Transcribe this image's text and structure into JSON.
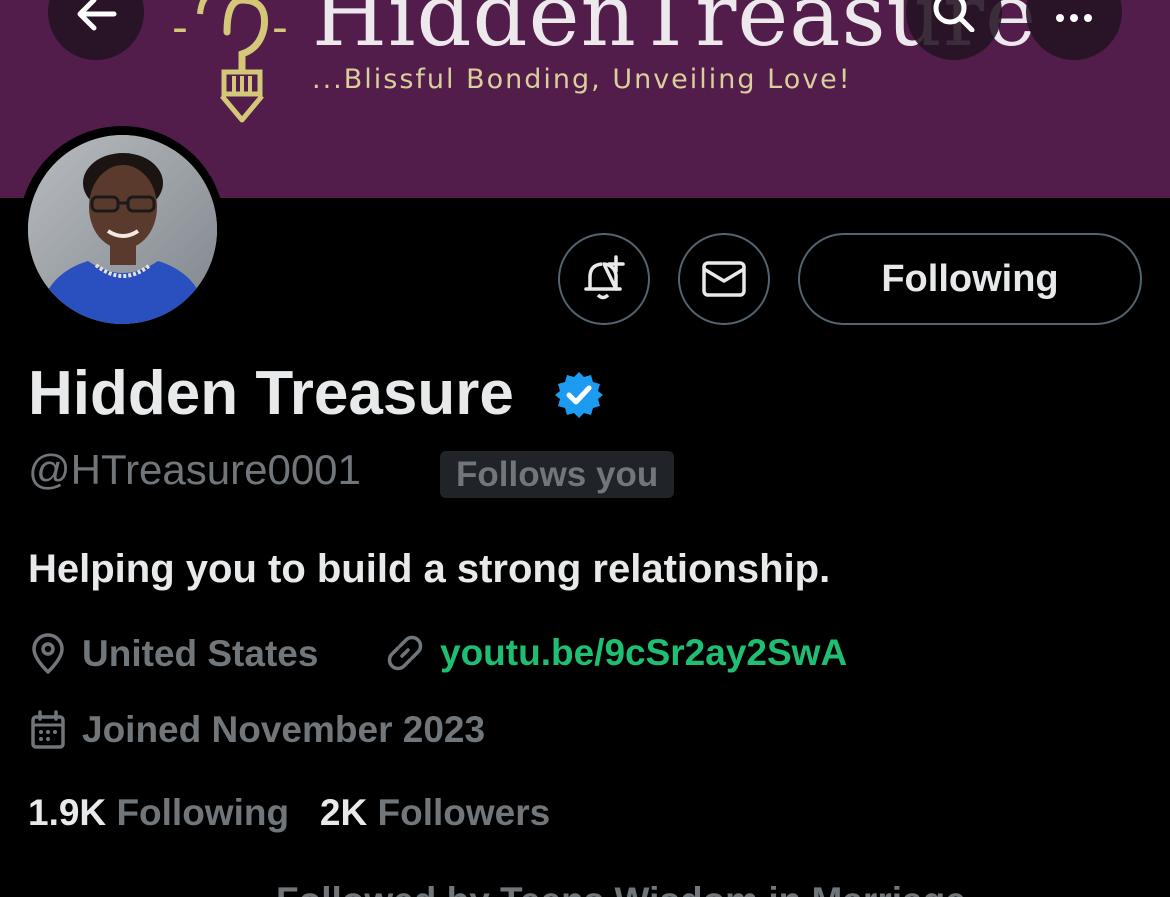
{
  "banner": {
    "brand_name": "HiddenTreasure",
    "tagline": "...Blissful Bonding, Unveiling Love!",
    "background_color": "#521c4b",
    "back_icon": "arrow-left-icon",
    "search_icon": "search-icon",
    "more_icon": "more-horizontal-icon"
  },
  "actions": {
    "notify_icon": "bell-plus-icon",
    "message_icon": "envelope-icon",
    "following_label": "Following"
  },
  "profile": {
    "display_name": "Hidden Treasure",
    "verified_icon": "verified-badge-icon",
    "handle": "@HTreasure0001",
    "follows_you": "Follows you",
    "bio": "Helping you to build a strong relationship.",
    "location": "United States",
    "link": "youtu.be/9cSr2ay2SwA",
    "joined": "Joined November 2023",
    "following_count": "1.9K",
    "following_label": "Following",
    "followers_count": "2K",
    "followers_label": "Followers",
    "followed_by": "Followed by Teens Wisdom in Marriage"
  },
  "colors": {
    "accent_link": "#1fbf73",
    "verified": "#1d9bf0",
    "muted_text": "#71767b",
    "primary_text": "#e7e9ea"
  }
}
